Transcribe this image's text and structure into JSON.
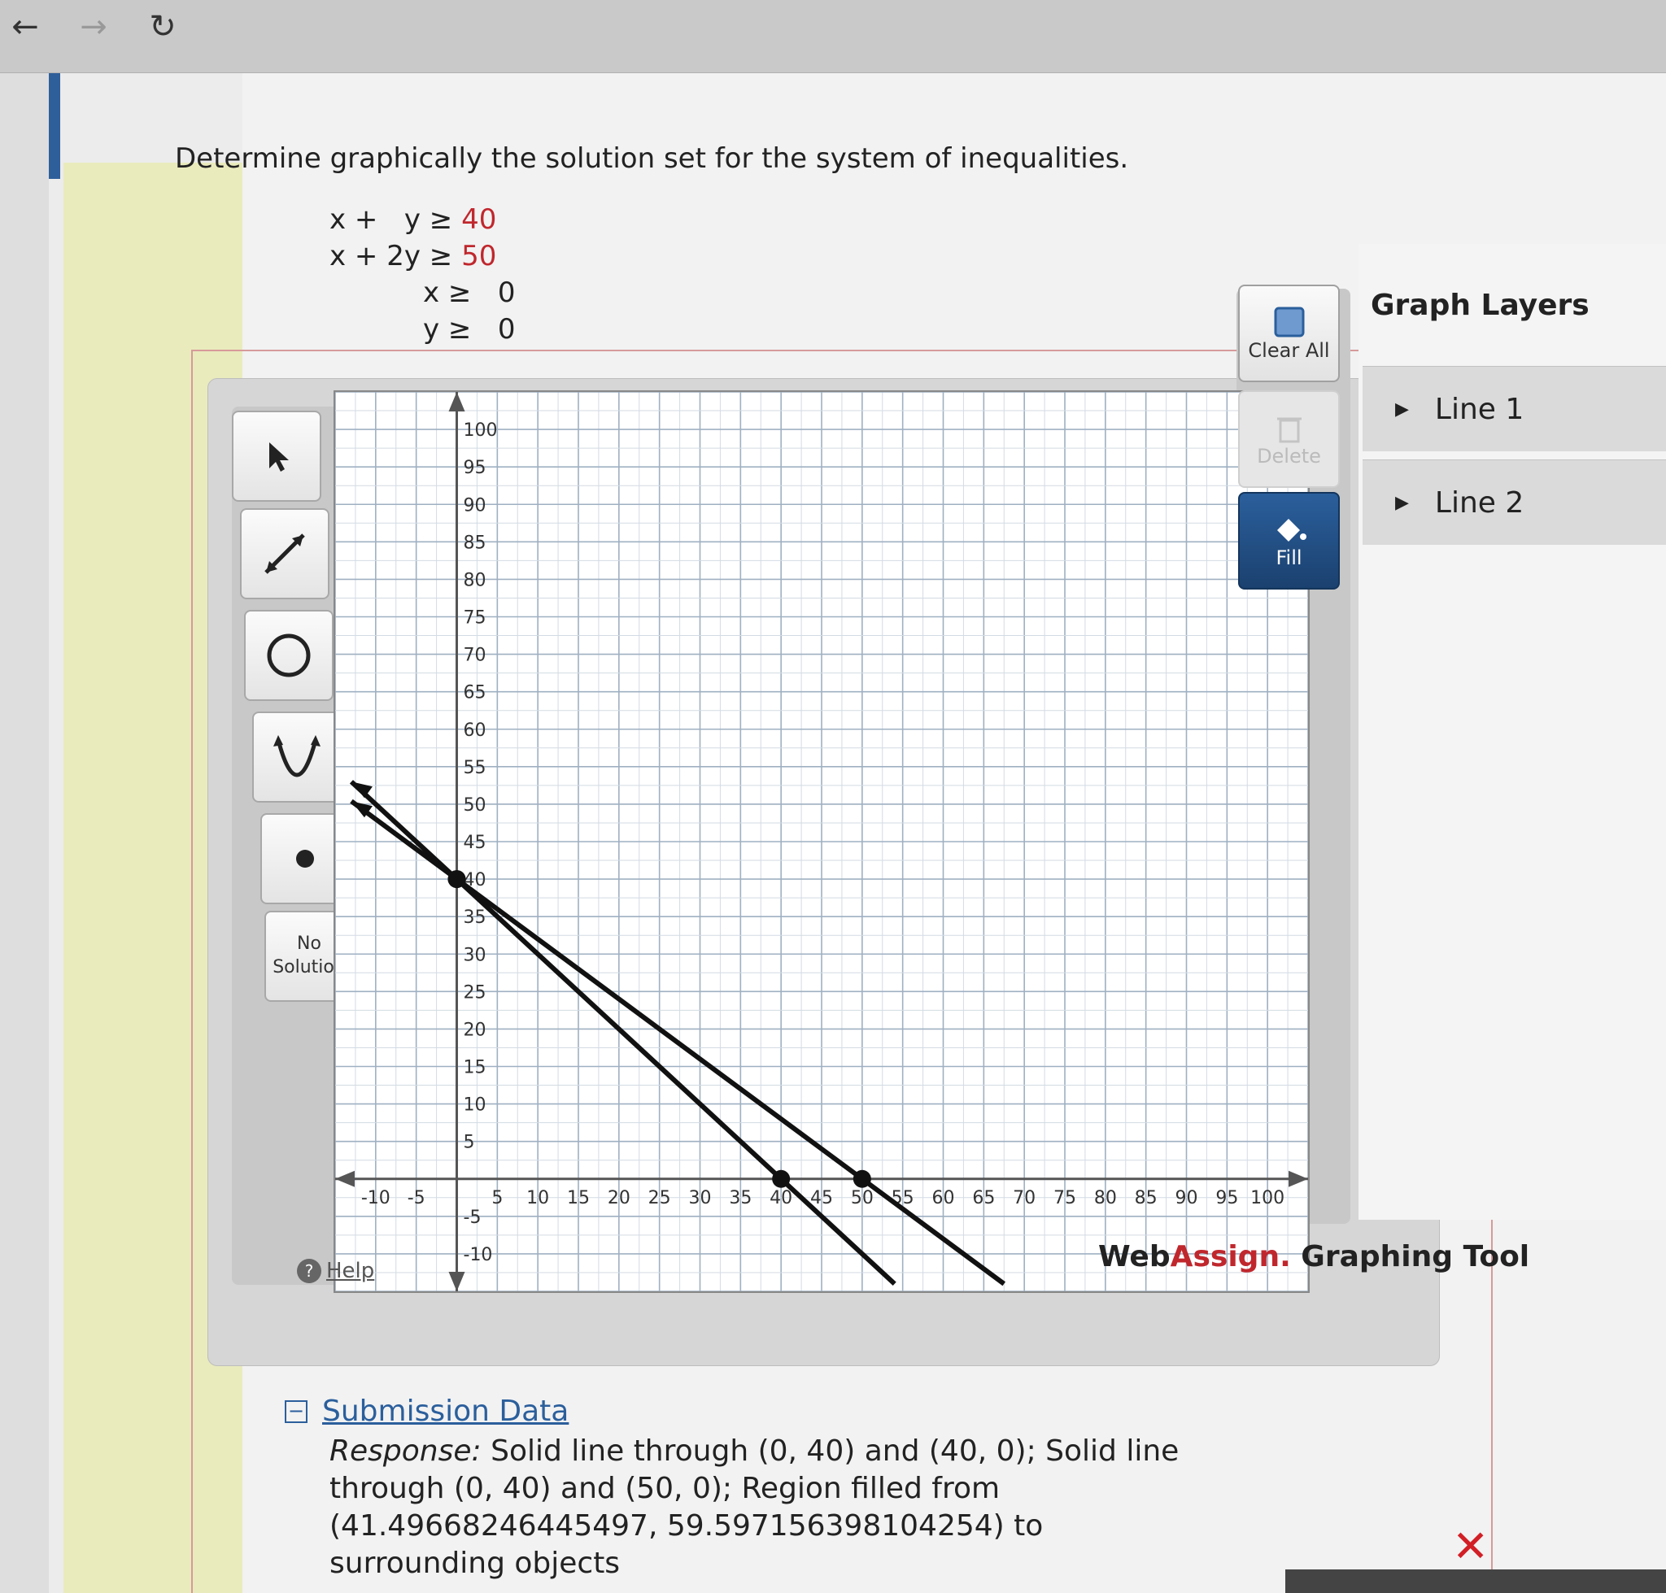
{
  "browser": {
    "back_icon": "arrow-left-icon",
    "forward_icon": "arrow-right-icon",
    "reload_icon": "reload-icon"
  },
  "question": {
    "prompt": "Determine graphically the solution set for the system of inequalities.",
    "inequalities": [
      {
        "lhs": "x +   y ≥",
        "rhs": "40"
      },
      {
        "lhs": "x + 2y ≥",
        "rhs": "50"
      },
      {
        "lhs": "x ≥",
        "rhs": "0"
      },
      {
        "lhs": "y ≥",
        "rhs": "0"
      }
    ]
  },
  "tools": {
    "no_solution_label": "No\nSolution",
    "help_label": "Help"
  },
  "actions": {
    "clear_all_label": "Clear All",
    "delete_label": "Delete",
    "fill_label": "Fill"
  },
  "layers": {
    "title": "Graph Layers",
    "items": [
      {
        "label": "Line 1"
      },
      {
        "label": "Line 2"
      }
    ]
  },
  "brand": {
    "name_dark": "Web",
    "name_red": "Assign.",
    "suffix": " Graphing Tool"
  },
  "submission": {
    "heading": "Submission Data",
    "response_label": "Response:",
    "response_text": " Solid line through (0, 40) and (40, 0); Solid line through (0, 40) and (50, 0); Region filled from (41.49668246445497, 59.597156398104254) to surrounding objects"
  },
  "graph": {
    "x_ticks": [
      "-10",
      "-5",
      "5",
      "10",
      "15",
      "20",
      "25",
      "30",
      "35",
      "40",
      "45",
      "50",
      "55",
      "60",
      "65",
      "70",
      "75",
      "80",
      "85",
      "90",
      "95",
      "100"
    ],
    "y_ticks": [
      "100",
      "95",
      "90",
      "85",
      "80",
      "75",
      "70",
      "65",
      "60",
      "55",
      "50",
      "45",
      "40",
      "35",
      "30",
      "25",
      "20",
      "15",
      "10",
      "5",
      "-5",
      "-10"
    ],
    "xlim": [
      -15,
      105
    ],
    "ylim": [
      -15,
      105
    ],
    "lines": [
      {
        "name": "Line 1",
        "p1": [
          0,
          40
        ],
        "p2": [
          40,
          0
        ]
      },
      {
        "name": "Line 2",
        "p1": [
          0,
          40
        ],
        "p2": [
          50,
          0
        ]
      }
    ]
  }
}
